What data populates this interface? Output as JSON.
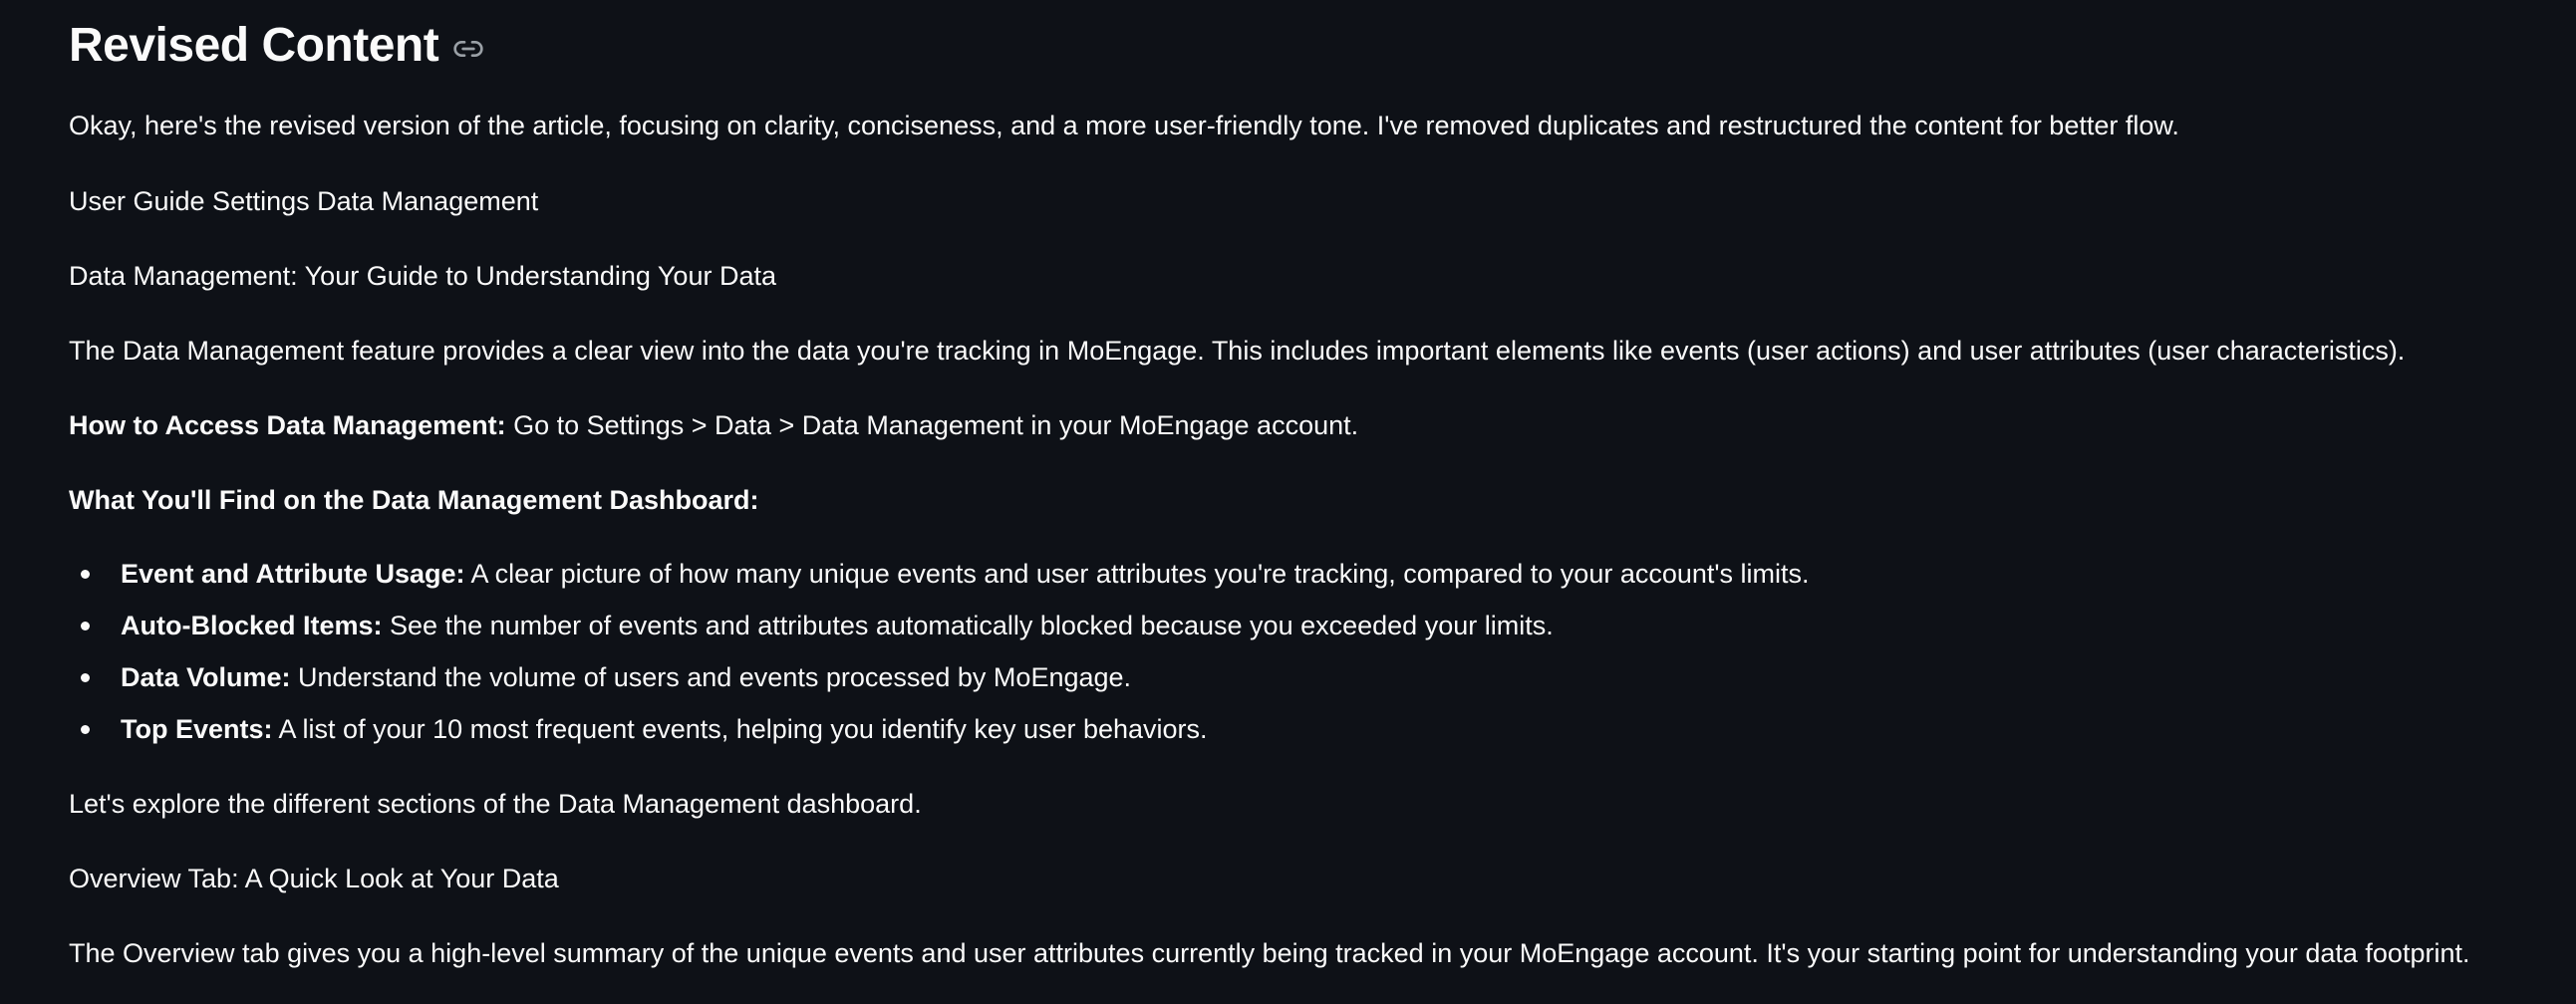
{
  "heading": "Revised Content",
  "intro": "Okay, here's the revised version of the article, focusing on clarity, conciseness, and a more user-friendly tone. I've removed duplicates and restructured the content for better flow.",
  "breadcrumb": "User Guide Settings Data Management",
  "subtitle": "Data Management: Your Guide to Understanding Your Data",
  "description": "The Data Management feature provides a clear view into the data you're tracking in MoEngage. This includes important elements like events (user actions) and user attributes (user characteristics).",
  "access": {
    "label": "How to Access Data Management:",
    "text": " Go to Settings > Data > Data Management in your MoEngage account."
  },
  "dashboard_heading": "What You'll Find on the Data Management Dashboard:",
  "bullets": [
    {
      "label": "Event and Attribute Usage:",
      "text": " A clear picture of how many unique events and user attributes you're tracking, compared to your account's limits."
    },
    {
      "label": "Auto-Blocked Items:",
      "text": " See the number of events and attributes automatically blocked because you exceeded your limits."
    },
    {
      "label": "Data Volume:",
      "text": " Understand the volume of users and events processed by MoEngage."
    },
    {
      "label": "Top Events:",
      "text": " A list of your 10 most frequent events, helping you identify key user behaviors."
    }
  ],
  "explore": "Let's explore the different sections of the Data Management dashboard.",
  "overview_title": "Overview Tab: A Quick Look at Your Data",
  "overview_text": "The Overview tab gives you a high-level summary of the unique events and user attributes currently being tracked in your MoEngage account. It's your starting point for understanding your data footprint.",
  "icons": {
    "heading_anchor": "link-icon"
  }
}
